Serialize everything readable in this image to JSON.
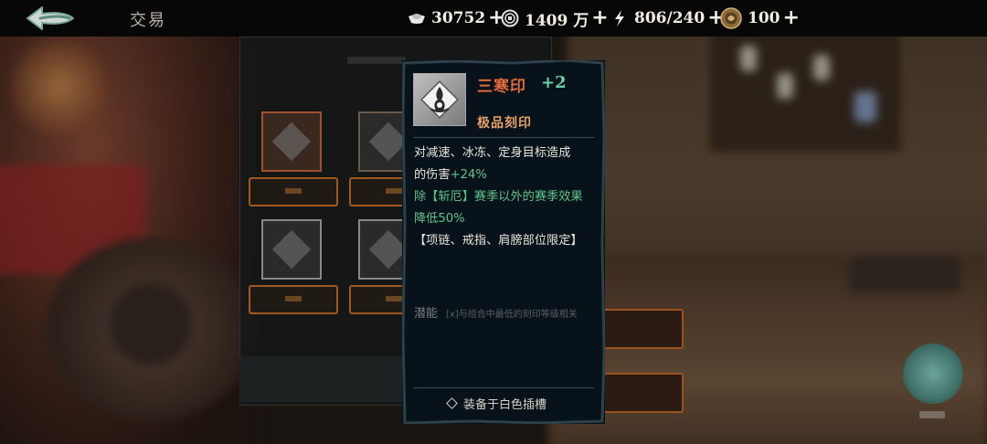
{
  "header": {
    "title": "交易",
    "resources": [
      {
        "icon": "ingot-icon",
        "value": "30752",
        "plus": "+"
      },
      {
        "icon": "coin-icon",
        "value": "1409 万",
        "plus": "+"
      },
      {
        "icon": "lightning-icon",
        "value": "806/240",
        "plus": "+"
      },
      {
        "icon": "token-icon",
        "value": "100",
        "plus": "+"
      }
    ]
  },
  "tooltip": {
    "name": "三寒印",
    "level": "+2",
    "grade": "极品刻印",
    "desc_line1": "对减速、冰冻、定身目标造成",
    "desc_line2_prefix": "的伤害",
    "desc_line2_value": "+24%",
    "desc_line3": "除【斩厄】赛季以外的赛季效果",
    "desc_line4": "降低50%",
    "desc_line5": "【项链、戒指、肩膀部位限定】",
    "potential_label": "潜能",
    "potential_bracket": "[x]",
    "potential_note": "与组合中最低的刻印等级相关",
    "equip_hint": "装备于白色插槽"
  },
  "colors": {
    "name": "#e26a3c",
    "level": "#6fd0a4",
    "grade": "#e8a26a",
    "effect_green": "#5ec58c"
  }
}
